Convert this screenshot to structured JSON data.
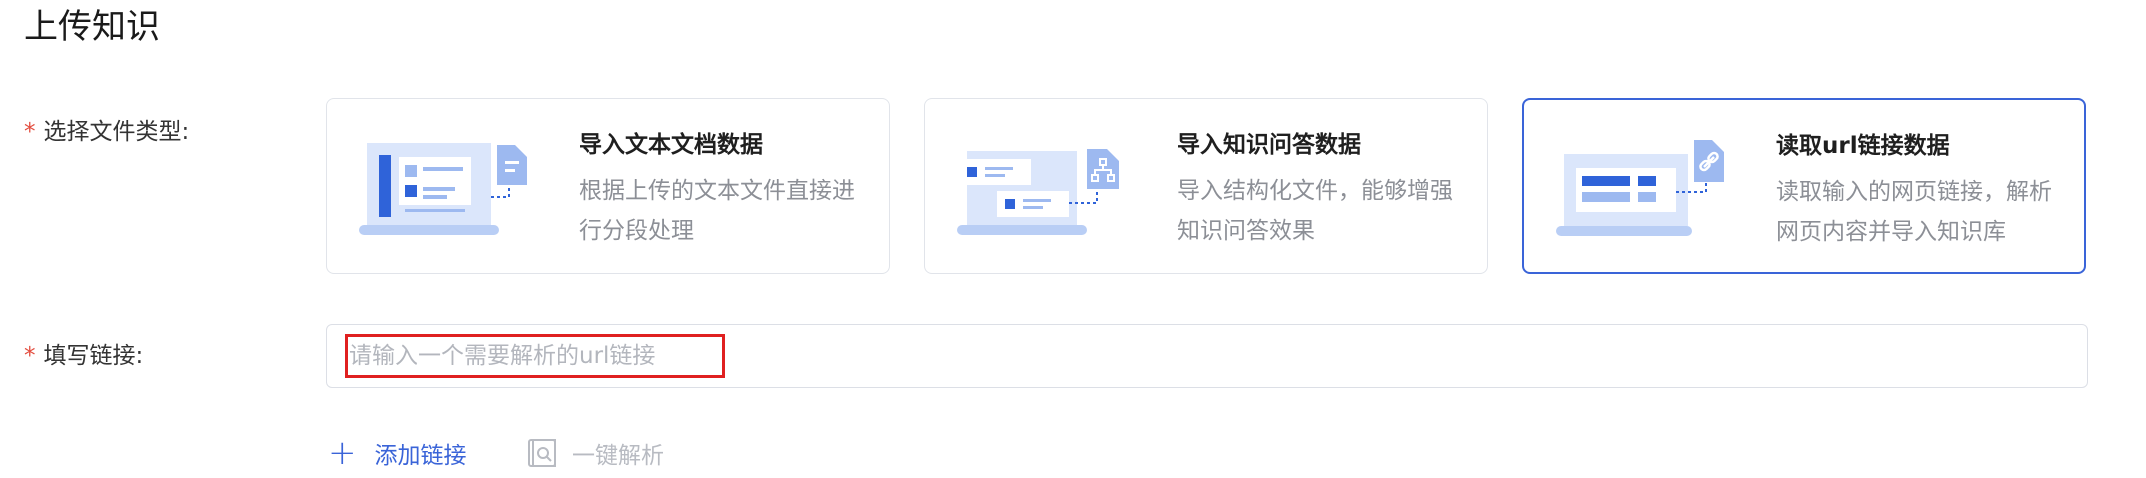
{
  "page": {
    "title": "上传知识"
  },
  "form": {
    "required_mark": "*",
    "file_type_label": "选择文件类型:",
    "link_label": "填写链接:"
  },
  "file_types": [
    {
      "title": "导入文本文档数据",
      "description": "根据上传的文本文件直接进行分段处理",
      "icon": "document-file-icon",
      "selected": false
    },
    {
      "title": "导入知识问答数据",
      "description": "导入结构化文件，能够增强知识问答效果",
      "icon": "qa-structure-icon",
      "selected": false
    },
    {
      "title": "读取url链接数据",
      "description": "读取输入的网页链接，解析网页内容并导入知识库",
      "icon": "link-icon",
      "selected": true
    }
  ],
  "url_input": {
    "placeholder": "请输入一个需要解析的url链接",
    "value": ""
  },
  "actions": {
    "add_link_label": "添加链接",
    "parse_label": "一键解析"
  },
  "colors": {
    "accent": "#3a64d8",
    "required": "#e34d3f",
    "highlight": "#e02020"
  }
}
